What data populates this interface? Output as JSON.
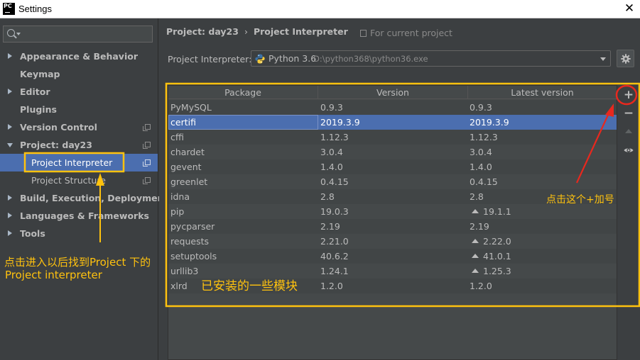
{
  "window": {
    "title": "Settings",
    "logo_text": "PC"
  },
  "sidebar": {
    "items": [
      {
        "label": "Appearance & Behavior",
        "arrow": "right"
      },
      {
        "label": "Keymap"
      },
      {
        "label": "Editor",
        "arrow": "right"
      },
      {
        "label": "Plugins"
      },
      {
        "label": "Version Control",
        "arrow": "right"
      },
      {
        "label": "Project: day23",
        "arrow": "down"
      },
      {
        "label": "Project Interpreter"
      },
      {
        "label": "Project Structure"
      },
      {
        "label": "Build, Execution, Deployment",
        "arrow": "right"
      },
      {
        "label": "Languages & Frameworks",
        "arrow": "right"
      },
      {
        "label": "Tools",
        "arrow": "right"
      }
    ]
  },
  "main": {
    "breadcrumb": {
      "project": "Project: day23",
      "separator": "›",
      "page": "Project Interpreter"
    },
    "for_current": "For current project",
    "interpreter_label": "Project Interpreter:",
    "interpreter_version": "Python 3.6",
    "interpreter_path": "D:\\python368\\python36.exe"
  },
  "table": {
    "headers": [
      "Package",
      "Version",
      "Latest version"
    ],
    "rows": [
      {
        "package": "PyMySQL",
        "version": "0.9.3",
        "latest": "0.9.3",
        "upgrade": false
      },
      {
        "package": "certifi",
        "version": "2019.3.9",
        "latest": "2019.3.9",
        "upgrade": false,
        "selected": true
      },
      {
        "package": "cffi",
        "version": "1.12.3",
        "latest": "1.12.3",
        "upgrade": false
      },
      {
        "package": "chardet",
        "version": "3.0.4",
        "latest": "3.0.4",
        "upgrade": false
      },
      {
        "package": "gevent",
        "version": "1.4.0",
        "latest": "1.4.0",
        "upgrade": false
      },
      {
        "package": "greenlet",
        "version": "0.4.15",
        "latest": "0.4.15",
        "upgrade": false
      },
      {
        "package": "idna",
        "version": "2.8",
        "latest": "2.8",
        "upgrade": false
      },
      {
        "package": "pip",
        "version": "19.0.3",
        "latest": "19.1.1",
        "upgrade": true
      },
      {
        "package": "pycparser",
        "version": "2.19",
        "latest": "2.19",
        "upgrade": false
      },
      {
        "package": "requests",
        "version": "2.21.0",
        "latest": "2.22.0",
        "upgrade": true
      },
      {
        "package": "setuptools",
        "version": "40.6.2",
        "latest": "41.0.1",
        "upgrade": true
      },
      {
        "package": "urllib3",
        "version": "1.24.1",
        "latest": "1.25.3",
        "upgrade": true
      },
      {
        "package": "xlrd",
        "version": "1.2.0",
        "latest": "1.2.0",
        "upgrade": false
      }
    ]
  },
  "toolbar": {
    "add_label": "+",
    "remove_label": "−"
  },
  "annotations": {
    "left_note_line1": "点击进入以后找到Project 下的",
    "left_note_line2": "Project interpreter",
    "table_note": "已安装的一些模块",
    "plus_note": "点击这个+加号",
    "color": "#ffc20e",
    "circle_color": "#e8281e"
  },
  "colors": {
    "selection": "#4b6eaf",
    "background": "#3c3f41",
    "table": "#45494a"
  }
}
